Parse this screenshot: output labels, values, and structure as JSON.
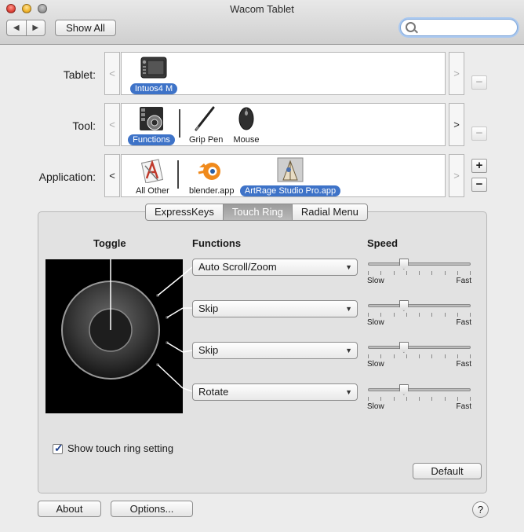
{
  "window": {
    "title": "Wacom Tablet"
  },
  "toolbar": {
    "back_icon": "triangle-left",
    "forward_icon": "triangle-right",
    "show_all_label": "Show All",
    "search_value": "",
    "search_placeholder": ""
  },
  "tablet": {
    "label": "Tablet:",
    "items": [
      {
        "label": "Intuos4 M",
        "icon": "tablet-icon",
        "selected": true
      }
    ]
  },
  "tool": {
    "label": "Tool:",
    "items": [
      {
        "label": "Functions",
        "icon": "functions-icon",
        "selected": true
      },
      {
        "label": "Grip Pen",
        "icon": "pen-icon",
        "selected": false
      },
      {
        "label": "Mouse",
        "icon": "mouse-icon",
        "selected": false
      }
    ]
  },
  "application": {
    "label": "Application:",
    "items": [
      {
        "label": "All Other",
        "icon": "all-other-icon",
        "selected": false
      },
      {
        "label": "blender.app",
        "icon": "blender-icon",
        "selected": false
      },
      {
        "label": "ArtRage Studio Pro.app",
        "icon": "artrage-icon",
        "selected": true
      }
    ]
  },
  "buttons": {
    "plus": "+",
    "minus": "−"
  },
  "tabs": [
    {
      "label": "ExpressKeys",
      "active": false
    },
    {
      "label": "Touch Ring",
      "active": true
    },
    {
      "label": "Radial Menu",
      "active": false
    }
  ],
  "touch_ring": {
    "toggle_heading": "Toggle",
    "functions_heading": "Functions",
    "speed_heading": "Speed",
    "functions": [
      {
        "value": "Auto Scroll/Zoom",
        "speed": 0.35
      },
      {
        "value": "Skip",
        "speed": 0.35
      },
      {
        "value": "Skip",
        "speed": 0.35
      },
      {
        "value": "Rotate",
        "speed": 0.35
      }
    ],
    "slow_label": "Slow",
    "fast_label": "Fast",
    "show_setting_label": "Show touch ring setting",
    "show_setting_checked": true,
    "default_label": "Default"
  },
  "footer": {
    "about_label": "About",
    "options_label": "Options...",
    "help_label": "?"
  }
}
